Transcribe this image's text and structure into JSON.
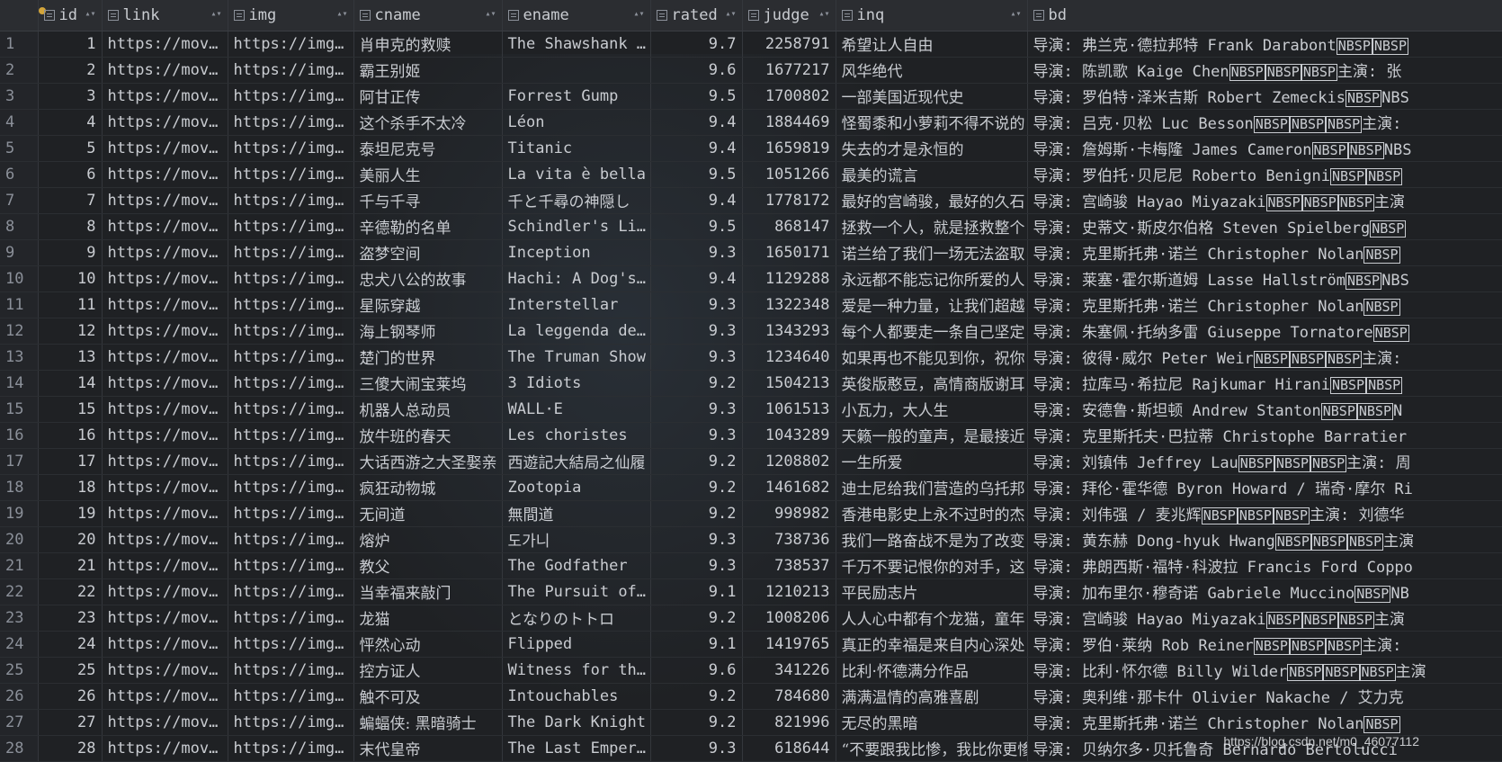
{
  "columns": [
    {
      "name": "",
      "key": "rownum"
    },
    {
      "name": "id",
      "key": "id"
    },
    {
      "name": "link",
      "key": "link"
    },
    {
      "name": "img",
      "key": "img"
    },
    {
      "name": "cname",
      "key": "cname"
    },
    {
      "name": "ename",
      "key": "ename"
    },
    {
      "name": "rated",
      "key": "rated"
    },
    {
      "name": "judge",
      "key": "judge"
    },
    {
      "name": "inq",
      "key": "inq"
    },
    {
      "name": "bd",
      "key": "bd"
    }
  ],
  "rows": [
    {
      "n": "1",
      "id": "1",
      "link": "https://mov…",
      "img": "https://img…",
      "cname": "肖申克的救赎",
      "ename": "The Shawshank …",
      "rated": "9.7",
      "judge": "2258791",
      "inq": "希望让人自由",
      "bd": "导演: 弗兰克·德拉邦特 Frank DarabontNBSPNBSP"
    },
    {
      "n": "2",
      "id": "2",
      "link": "https://mov…",
      "img": "https://img…",
      "cname": "霸王别姬",
      "ename": "",
      "rated": "9.6",
      "judge": "1677217",
      "inq": "风华绝代",
      "bd": "导演: 陈凯歌 Kaige ChenNBSPNBSPNBSP主演: 张"
    },
    {
      "n": "3",
      "id": "3",
      "link": "https://mov…",
      "img": "https://img…",
      "cname": "阿甘正传",
      "ename": "Forrest Gump",
      "rated": "9.5",
      "judge": "1700802",
      "inq": "一部美国近现代史",
      "bd": "导演: 罗伯特·泽米吉斯 Robert ZemeckisNBSPNBS"
    },
    {
      "n": "4",
      "id": "4",
      "link": "https://mov…",
      "img": "https://img…",
      "cname": "这个杀手不太冷",
      "ename": "Léon",
      "rated": "9.4",
      "judge": "1884469",
      "inq": "怪蜀黍和小萝莉不得不说的",
      "bd": "导演: 吕克·贝松 Luc BessonNBSPNBSPNBSP主演:"
    },
    {
      "n": "5",
      "id": "5",
      "link": "https://mov…",
      "img": "https://img…",
      "cname": "泰坦尼克号",
      "ename": "Titanic",
      "rated": "9.4",
      "judge": "1659819",
      "inq": "失去的才是永恒的",
      "bd": "导演: 詹姆斯·卡梅隆 James CameronNBSPNBSPNBS"
    },
    {
      "n": "6",
      "id": "6",
      "link": "https://mov…",
      "img": "https://img…",
      "cname": "美丽人生",
      "ename": "La vita è bella",
      "rated": "9.5",
      "judge": "1051266",
      "inq": "最美的谎言",
      "bd": "导演: 罗伯托·贝尼尼 Roberto BenigniNBSPNBSP"
    },
    {
      "n": "7",
      "id": "7",
      "link": "https://mov…",
      "img": "https://img…",
      "cname": "千与千寻",
      "ename": "千と千尋の神隠し",
      "rated": "9.4",
      "judge": "1778172",
      "inq": "最好的宫崎骏，最好的久石",
      "bd": "导演: 宫崎骏 Hayao MiyazakiNBSPNBSPNBSP主演"
    },
    {
      "n": "8",
      "id": "8",
      "link": "https://mov…",
      "img": "https://img…",
      "cname": "辛德勒的名单",
      "ename": "Schindler's Li…",
      "rated": "9.5",
      "judge": "868147",
      "inq": "拯救一个人，就是拯救整个",
      "bd": "导演: 史蒂文·斯皮尔伯格 Steven SpielbergNBSP"
    },
    {
      "n": "9",
      "id": "9",
      "link": "https://mov…",
      "img": "https://img…",
      "cname": "盗梦空间",
      "ename": "Inception",
      "rated": "9.3",
      "judge": "1650171",
      "inq": "诺兰给了我们一场无法盗取",
      "bd": "导演: 克里斯托弗·诺兰 Christopher NolanNBSP"
    },
    {
      "n": "10",
      "id": "10",
      "link": "https://mov…",
      "img": "https://img…",
      "cname": "忠犬八公的故事",
      "ename": "Hachi: A Dog's…",
      "rated": "9.4",
      "judge": "1129288",
      "inq": "永远都不能忘记你所爱的人",
      "bd": "导演: 莱塞·霍尔斯道姆 Lasse HallströmNBSPNBS"
    },
    {
      "n": "11",
      "id": "11",
      "link": "https://mov…",
      "img": "https://img…",
      "cname": "星际穿越",
      "ename": "Interstellar",
      "rated": "9.3",
      "judge": "1322348",
      "inq": "爱是一种力量，让我们超越",
      "bd": "导演: 克里斯托弗·诺兰 Christopher NolanNBSP"
    },
    {
      "n": "12",
      "id": "12",
      "link": "https://mov…",
      "img": "https://img…",
      "cname": "海上钢琴师",
      "ename": "La leggenda de…",
      "rated": "9.3",
      "judge": "1343293",
      "inq": "每个人都要走一条自己坚定",
      "bd": "导演: 朱塞佩·托纳多雷 Giuseppe TornatoreNBSP"
    },
    {
      "n": "13",
      "id": "13",
      "link": "https://mov…",
      "img": "https://img…",
      "cname": "楚门的世界",
      "ename": "The Truman Show",
      "rated": "9.3",
      "judge": "1234640",
      "inq": "如果再也不能见到你，祝你",
      "bd": "导演: 彼得·威尔 Peter WeirNBSPNBSPNBSP主演:"
    },
    {
      "n": "14",
      "id": "14",
      "link": "https://mov…",
      "img": "https://img…",
      "cname": "三傻大闹宝莱坞",
      "ename": "3 Idiots",
      "rated": "9.2",
      "judge": "1504213",
      "inq": "英俊版憨豆，高情商版谢耳",
      "bd": "导演: 拉库马·希拉尼 Rajkumar HiraniNBSPNBSP"
    },
    {
      "n": "15",
      "id": "15",
      "link": "https://mov…",
      "img": "https://img…",
      "cname": "机器人总动员",
      "ename": "WALL·E",
      "rated": "9.3",
      "judge": "1061513",
      "inq": "小瓦力，大人生",
      "bd": "导演: 安德鲁·斯坦顿 Andrew StantonNBSPNBSPN"
    },
    {
      "n": "16",
      "id": "16",
      "link": "https://mov…",
      "img": "https://img…",
      "cname": "放牛班的春天",
      "ename": "Les choristes",
      "rated": "9.3",
      "judge": "1043289",
      "inq": "天籁一般的童声，是最接近",
      "bd": "导演: 克里斯托夫·巴拉蒂 Christophe Barratier"
    },
    {
      "n": "17",
      "id": "17",
      "link": "https://mov…",
      "img": "https://img…",
      "cname": "大话西游之大圣娶亲",
      "ename": "西遊記大結局之仙履",
      "rated": "9.2",
      "judge": "1208802",
      "inq": "一生所爱",
      "bd": "导演: 刘镇伟 Jeffrey LauNBSPNBSPNBSP主演: 周"
    },
    {
      "n": "18",
      "id": "18",
      "link": "https://mov…",
      "img": "https://img…",
      "cname": "疯狂动物城",
      "ename": "Zootopia",
      "rated": "9.2",
      "judge": "1461682",
      "inq": "迪士尼给我们营造的乌托邦",
      "bd": "导演: 拜伦·霍华德 Byron Howard / 瑞奇·摩尔 Ri"
    },
    {
      "n": "19",
      "id": "19",
      "link": "https://mov…",
      "img": "https://img…",
      "cname": "无间道",
      "ename": "無間道",
      "rated": "9.2",
      "judge": "998982",
      "inq": "香港电影史上永不过时的杰",
      "bd": "导演: 刘伟强 / 麦兆辉NBSPNBSPNBSP主演: 刘德华"
    },
    {
      "n": "20",
      "id": "20",
      "link": "https://mov…",
      "img": "https://img…",
      "cname": "熔炉",
      "ename": "도가니",
      "rated": "9.3",
      "judge": "738736",
      "inq": "我们一路奋战不是为了改变",
      "bd": "导演: 黄东赫 Dong-hyuk HwangNBSPNBSPNBSP主演"
    },
    {
      "n": "21",
      "id": "21",
      "link": "https://mov…",
      "img": "https://img…",
      "cname": "教父",
      "ename": "The Godfather",
      "rated": "9.3",
      "judge": "738537",
      "inq": "千万不要记恨你的对手，这",
      "bd": "导演: 弗朗西斯·福特·科波拉 Francis Ford Coppo"
    },
    {
      "n": "22",
      "id": "22",
      "link": "https://mov…",
      "img": "https://img…",
      "cname": "当幸福来敲门",
      "ename": "The Pursuit of…",
      "rated": "9.1",
      "judge": "1210213",
      "inq": "平民励志片",
      "bd": "导演: 加布里尔·穆奇诺 Gabriele MuccinoNBSPNB"
    },
    {
      "n": "23",
      "id": "23",
      "link": "https://mov…",
      "img": "https://img…",
      "cname": "龙猫",
      "ename": "となりのトトロ",
      "rated": "9.2",
      "judge": "1008206",
      "inq": "人人心中都有个龙猫，童年",
      "bd": "导演: 宫崎骏 Hayao MiyazakiNBSPNBSPNBSP主演"
    },
    {
      "n": "24",
      "id": "24",
      "link": "https://mov…",
      "img": "https://img…",
      "cname": "怦然心动",
      "ename": "Flipped",
      "rated": "9.1",
      "judge": "1419765",
      "inq": "真正的幸福是来自内心深处",
      "bd": "导演: 罗伯·莱纳 Rob ReinerNBSPNBSPNBSP主演:"
    },
    {
      "n": "25",
      "id": "25",
      "link": "https://mov…",
      "img": "https://img…",
      "cname": "控方证人",
      "ename": "Witness for th…",
      "rated": "9.6",
      "judge": "341226",
      "inq": "比利·怀德满分作品",
      "bd": "导演: 比利·怀尔德 Billy WilderNBSPNBSPNBSP主演"
    },
    {
      "n": "26",
      "id": "26",
      "link": "https://mov…",
      "img": "https://img…",
      "cname": "触不可及",
      "ename": "Intouchables",
      "rated": "9.2",
      "judge": "784680",
      "inq": "满满温情的高雅喜剧",
      "bd": "导演: 奥利维·那卡什 Olivier Nakache / 艾力克"
    },
    {
      "n": "27",
      "id": "27",
      "link": "https://mov…",
      "img": "https://img…",
      "cname": "蝙蝠侠: 黑暗骑士",
      "ename": "The Dark Knight",
      "rated": "9.2",
      "judge": "821996",
      "inq": "无尽的黑暗",
      "bd": "导演: 克里斯托弗·诺兰 Christopher NolanNBSP"
    },
    {
      "n": "28",
      "id": "28",
      "link": "https://mov…",
      "img": "https://img…",
      "cname": "末代皇帝",
      "ename": "The Last Emper…",
      "rated": "9.3",
      "judge": "618644",
      "inq": "“不要跟我比惨，我比你更惨",
      "bd": "导演: 贝纳尔多·贝托鲁奇 Bernardo Bertolucci"
    }
  ],
  "watermark": "https://blog.csdn.net/m0_46077112"
}
